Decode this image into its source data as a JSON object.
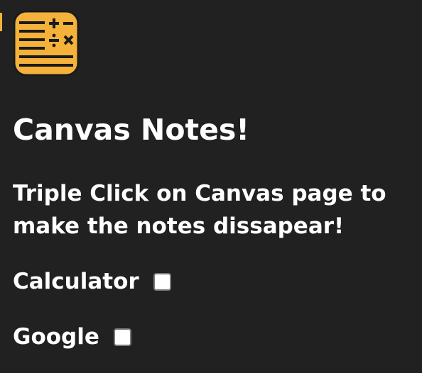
{
  "popup": {
    "logo_icon": "calculator-notes-icon",
    "title": "Canvas Notes!",
    "instructions": "Triple Click on Canvas page to make the notes dissapear!",
    "options": [
      {
        "label": "Calculator",
        "checked": false
      },
      {
        "label": "Google",
        "checked": false
      }
    ]
  },
  "colors": {
    "background": "#212121",
    "text": "#ffffff",
    "logo_fill": "#f5b23a",
    "logo_ink": "#1a1a1a"
  }
}
